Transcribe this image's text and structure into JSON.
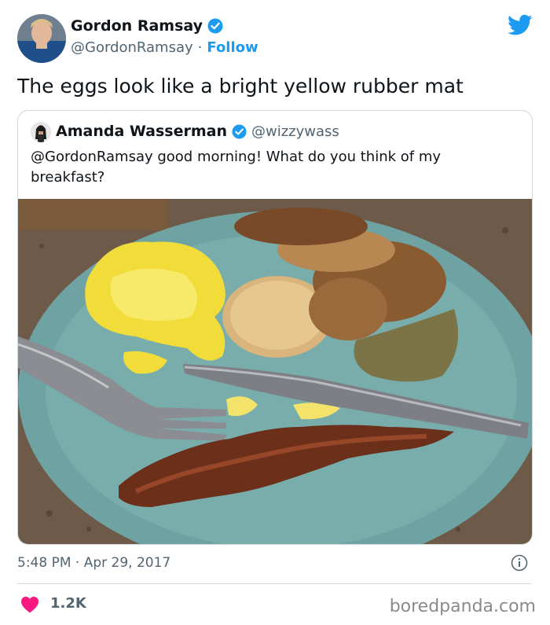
{
  "author": {
    "name": "Gordon Ramsay",
    "handle": "@GordonRamsay",
    "separator": "·",
    "follow_label": "Follow",
    "icon": "avatar"
  },
  "tweet": {
    "text": "The eggs look like a bright yellow rubber mat",
    "timestamp": "5:48 PM · Apr 29, 2017",
    "likes": "1.2K"
  },
  "quoted_tweet": {
    "name": "Amanda Wasserman",
    "handle": "@wizzywass",
    "text": "@GordonRamsay good morning! What do you think of my breakfast?",
    "photo_icon": "breakfast-photo"
  },
  "footer": {
    "watermark": "boredpanda.com"
  },
  "colors": {
    "verified": "#1d9bf0",
    "twitter_blue": "#1d9bf0",
    "heart": "#f91880",
    "secondary_text": "#536471"
  }
}
